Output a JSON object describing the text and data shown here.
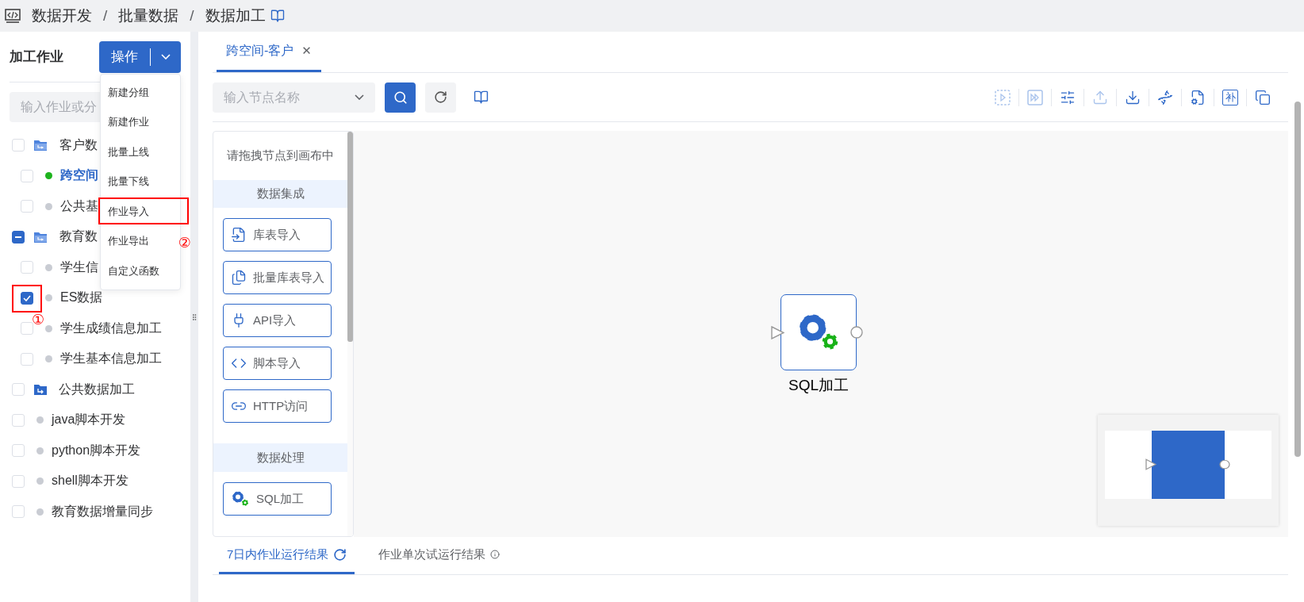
{
  "breadcrumb": {
    "separator": "/",
    "items": [
      "数据开发",
      "批量数据",
      "数据加工"
    ]
  },
  "left_panel": {
    "title": "加工作业",
    "action_button": {
      "label": "操作"
    },
    "search": {
      "placeholder": "输入作业或分"
    },
    "tree": [
      {
        "kind": "folder",
        "label": "客户数",
        "checked": false,
        "selected": false,
        "children": [
          {
            "kind": "job",
            "label": "跨空间",
            "checked": false,
            "selected": true,
            "color": "#1db31d"
          },
          {
            "kind": "job",
            "label": "公共基",
            "checked": false,
            "selected": false,
            "color": "#c9ccd3"
          }
        ]
      },
      {
        "kind": "folder",
        "label": "教育数",
        "checked": false,
        "partial": true,
        "selected": false,
        "children": [
          {
            "kind": "job",
            "label": "学生信",
            "checked": false,
            "selected": false,
            "color": "#c9ccd3"
          },
          {
            "kind": "job",
            "label": "ES数据",
            "checked": true,
            "selected": false,
            "highlighted": true,
            "note": "①",
            "color": "#c9ccd3"
          },
          {
            "kind": "job",
            "label": "学生成绩信息加工",
            "checked": false,
            "selected": false,
            "color": "#c9ccd3"
          },
          {
            "kind": "job",
            "label": "学生基本信息加工",
            "checked": false,
            "selected": false,
            "color": "#c9ccd3"
          }
        ]
      },
      {
        "kind": "link-folder",
        "label": "公共数据加工",
        "checked": false,
        "selected": false
      },
      {
        "kind": "job",
        "label": "java脚本开发",
        "checked": false,
        "selected": false,
        "color": "#c9ccd3"
      },
      {
        "kind": "job",
        "label": "python脚本开发",
        "checked": false,
        "selected": false,
        "color": "#c9ccd3"
      },
      {
        "kind": "job",
        "label": "shell脚本开发",
        "checked": false,
        "selected": false,
        "color": "#c9ccd3"
      },
      {
        "kind": "job",
        "label": "教育数据增量同步",
        "checked": false,
        "selected": false,
        "color": "#c9ccd3"
      }
    ],
    "menu": [
      {
        "label": "新建分组"
      },
      {
        "label": "新建作业"
      },
      {
        "label": "批量上线"
      },
      {
        "label": "批量下线"
      },
      {
        "label": "作业导入",
        "highlighted": true
      },
      {
        "label": "作业导出",
        "note": "②"
      },
      {
        "label": "自定义函数"
      }
    ]
  },
  "tabs": [
    {
      "label": "跨空间-客户",
      "selected": true,
      "close": "✕"
    }
  ],
  "toolbar": {
    "node_search": {
      "placeholder": "输入节点名称"
    },
    "tools": [
      {
        "kind": "run-selection",
        "disabled": true
      },
      {
        "kind": "run-from",
        "disabled": true
      },
      {
        "kind": "sliders",
        "disabled": false
      },
      {
        "kind": "upload",
        "disabled": true
      },
      {
        "kind": "download",
        "disabled": false
      },
      {
        "kind": "dna",
        "disabled": false
      },
      {
        "kind": "doc-settings",
        "disabled": false
      },
      {
        "kind": "supplement",
        "label": "补",
        "disabled": false
      },
      {
        "kind": "windows",
        "disabled": false
      }
    ]
  },
  "palette": {
    "hint": "请拖拽节点到画布中",
    "sections": [
      {
        "title": "数据集成",
        "nodes": [
          {
            "kind": "table-import",
            "label": "库表导入"
          },
          {
            "kind": "batch-import",
            "label": "批量库表导入"
          },
          {
            "kind": "api",
            "label": "API导入"
          },
          {
            "kind": "script",
            "label": "脚本导入"
          },
          {
            "kind": "http",
            "label": "HTTP访问"
          }
        ]
      },
      {
        "title": "数据处理",
        "nodes": [
          {
            "kind": "sql",
            "label": "SQL加工"
          }
        ]
      }
    ]
  },
  "canvas": {
    "nodes": [
      {
        "kind": "sql",
        "label": "SQL加工"
      }
    ]
  },
  "bottom_tabs": [
    {
      "label": "7日内作业运行结果",
      "selected": true,
      "kind": "refresh"
    },
    {
      "label": "作业单次试运行结果",
      "selected": false,
      "kind": "info"
    }
  ]
}
